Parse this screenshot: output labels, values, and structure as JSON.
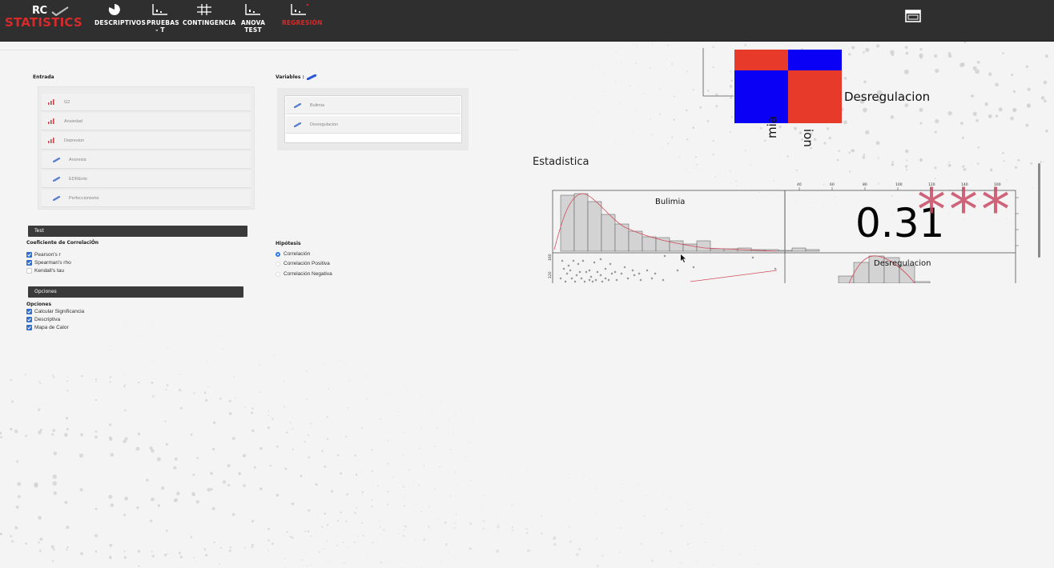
{
  "app": {
    "logo_top": "RC",
    "logo_bottom": "STATISTICS"
  },
  "nav": {
    "items": [
      {
        "label": "DESCRIPTIVOS",
        "icon": "pie-chart-icon"
      },
      {
        "label": "PRUEBAS - T",
        "icon": "bar-chart-icon"
      },
      {
        "label": "CONTINGENCIA",
        "icon": "grid-icon"
      },
      {
        "label": "ANOVA TEST",
        "icon": "bar-chart-icon"
      },
      {
        "label": "REGRESIÓN",
        "icon": "bar-chart-icon",
        "active": true
      }
    ],
    "window_icon": "window-icon"
  },
  "entrada": {
    "label": "Entrada",
    "items": [
      {
        "label": "G2",
        "icon": "ordinal-icon"
      },
      {
        "label": "Ansiedad",
        "icon": "ordinal-icon"
      },
      {
        "label": "Depresion",
        "icon": "ordinal-icon"
      },
      {
        "label": "Anorexia",
        "icon": "continuous-icon"
      },
      {
        "label": "EDREnte",
        "icon": "continuous-icon"
      },
      {
        "label": "Perfeccionismo",
        "icon": "continuous-icon"
      }
    ]
  },
  "variables": {
    "label": "Variables :",
    "items": [
      {
        "label": "Bulimia",
        "icon": "continuous-icon"
      },
      {
        "label": "Desregulacion",
        "icon": "continuous-icon"
      }
    ]
  },
  "test": {
    "header": "Test",
    "coef_label": "Coeficiente de CorrelaciÓn",
    "options": [
      {
        "label": "Pearson's r",
        "checked": true
      },
      {
        "label": "Spearman's rho",
        "checked": true
      },
      {
        "label": "Kendall's tau",
        "checked": false
      }
    ],
    "hipotesis_label": "Hipótesis",
    "hipotesis": [
      {
        "label": "Correlación",
        "selected": true
      },
      {
        "label": "Correlación Positiva",
        "selected": false
      },
      {
        "label": "Correlación Negativa",
        "selected": false
      }
    ]
  },
  "opciones": {
    "header": "Opciones",
    "label": "Opciones",
    "items": [
      {
        "label": "Calcular Significancia",
        "checked": true
      },
      {
        "label": "Descriptiva",
        "checked": true
      },
      {
        "label": "Mapa de Calor",
        "checked": true
      }
    ]
  },
  "results": {
    "heatmap_label_right": "Desregulacion",
    "heatmap_x_label_1": "mia",
    "heatmap_x_label_2": "ion",
    "heatmap_colors": [
      "#e83a2a",
      "#0a00f5",
      "#0a00f5",
      "#e83a2a"
    ],
    "section_title": "Estadistica",
    "top_axis_ticks": [
      "40",
      "60",
      "80",
      "100",
      "120",
      "140",
      "160"
    ],
    "diag_label_1": "Bulimia",
    "diag_label_2": "Desregulacion",
    "corr_value": "0.31",
    "significance": "***",
    "left_axis_ticks": [
      "160",
      "120"
    ],
    "star_color": "#c94a64"
  }
}
